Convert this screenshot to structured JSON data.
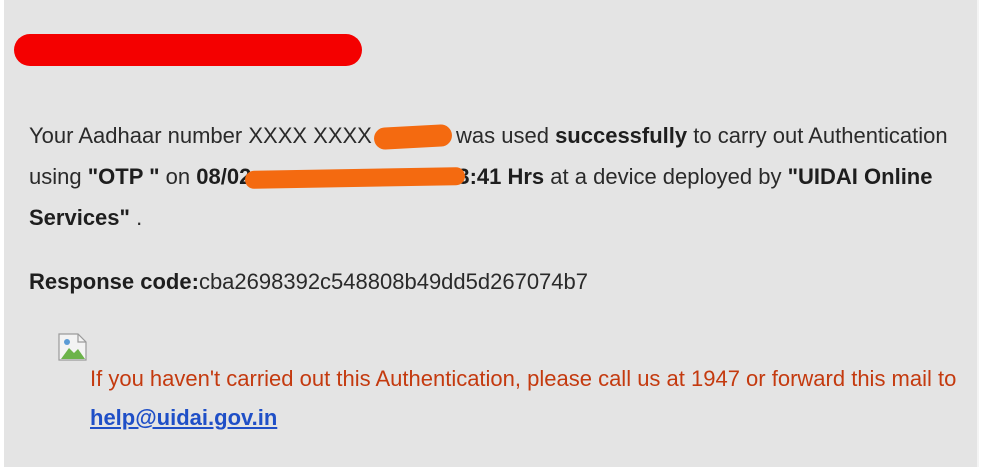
{
  "message": {
    "intro": "Your Aadhaar number XXXX XXXX",
    "after_masked_number": "was used",
    "success_word": "successfully",
    "text_carry_out": "to carry out Authentication using",
    "auth_method": "\"OTP \"",
    "text_on": "on",
    "timestamp_start": "08/02",
    "timestamp_end": "3:41 Hrs",
    "text_device": "at a device deployed by",
    "device_name": "\"UIDAI Online Services\"",
    "text_end": "."
  },
  "response": {
    "label": "Response code:",
    "code": "cba2698392c548808b49dd5d267074b7"
  },
  "warning": {
    "text": "If you haven't carried out this Authentication, please call us at 1947 or forward this mail to",
    "email": "help@uidai.gov.in"
  },
  "colors": {
    "background": "#e4e4e4",
    "redaction_red": "#f40000",
    "redaction_orange": "#f46a10",
    "warning_text": "#c43a0f",
    "link": "#1f4fc7"
  },
  "icons": {
    "broken_image": "broken-image-icon"
  }
}
